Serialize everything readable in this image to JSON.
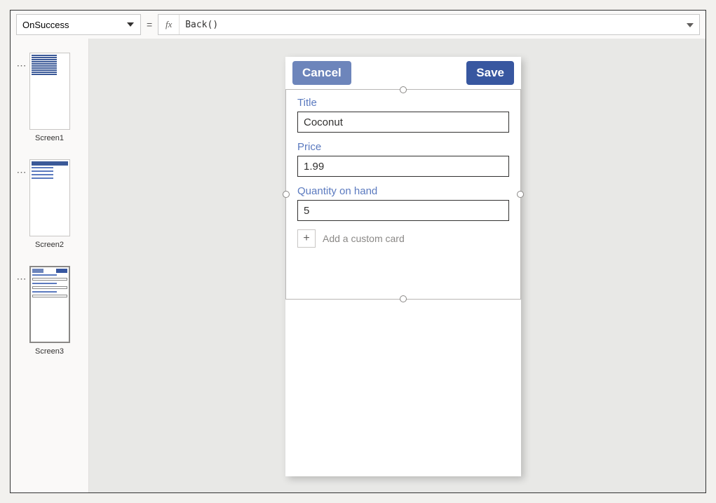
{
  "formula_bar": {
    "property": "OnSuccess",
    "equals": "=",
    "fx_label": "fx",
    "formula": "Back()"
  },
  "thumbnails": {
    "screen1": "Screen1",
    "screen2": "Screen2",
    "screen3": "Screen3"
  },
  "phone": {
    "cancel_label": "Cancel",
    "save_label": "Save",
    "fields": {
      "title_label": "Title",
      "title_value": "Coconut",
      "price_label": "Price",
      "price_value": "1.99",
      "qty_label": "Quantity on hand",
      "qty_value": "5"
    },
    "add_card": "Add a custom card"
  }
}
